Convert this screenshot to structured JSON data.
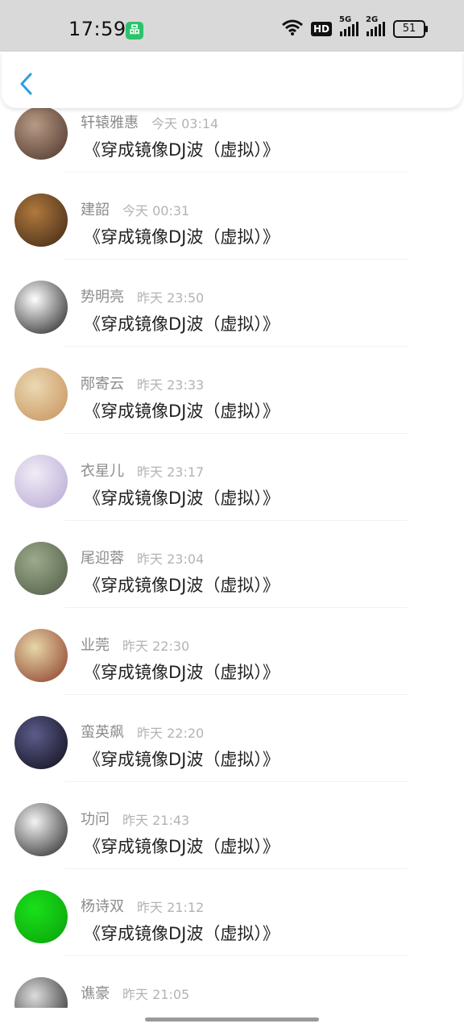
{
  "status_bar": {
    "time": "17:59",
    "app_badge": "品",
    "hd": "HD",
    "sig1": "5G",
    "sig2": "2G",
    "battery": "51"
  },
  "nav": {
    "back_icon": "chevron-left-icon",
    "accent": "#2b9de8"
  },
  "items": [
    {
      "name": "轩辕雅惠",
      "time": "今天 03:14",
      "message": "《穿成镜像DJ波（虚拟）》",
      "avatar": [
        "#b89a86",
        "#4a3328"
      ]
    },
    {
      "name": "建韶",
      "time": "今天 00:31",
      "message": "《穿成镜像DJ波（虚拟）》",
      "avatar": [
        "#b0793d",
        "#3d2714"
      ]
    },
    {
      "name": "势明亮",
      "time": "昨天 23:50",
      "message": "《穿成镜像DJ波（虚拟）》",
      "avatar": [
        "#ffffff",
        "#1c1c1c"
      ]
    },
    {
      "name": "邴寄云",
      "time": "昨天 23:33",
      "message": "《穿成镜像DJ波（虚拟）》",
      "avatar": [
        "#ead9b2",
        "#c7905a"
      ]
    },
    {
      "name": "衣星儿",
      "time": "昨天 23:17",
      "message": "《穿成镜像DJ波（虚拟）》",
      "avatar": [
        "#f0ecf6",
        "#b7a7d3"
      ]
    },
    {
      "name": "尾迎蓉",
      "time": "昨天 23:04",
      "message": "《穿成镜像DJ波（虚拟）》",
      "avatar": [
        "#9cab8c",
        "#4e5a44"
      ]
    },
    {
      "name": "业莞",
      "time": "昨天 22:30",
      "message": "《穿成镜像DJ波（虚拟）》",
      "avatar": [
        "#e7d6a8",
        "#8a3a26"
      ]
    },
    {
      "name": "蛮英飙",
      "time": "昨天 22:20",
      "message": "《穿成镜像DJ波（虚拟）》",
      "avatar": [
        "#5c5c8c",
        "#0d0d18"
      ]
    },
    {
      "name": "功问",
      "time": "昨天 21:43",
      "message": "《穿成镜像DJ波（虚拟）》",
      "avatar": [
        "#f4f4f4",
        "#222222"
      ]
    },
    {
      "name": "杨诗双",
      "time": "昨天 21:12",
      "message": "《穿成镜像DJ波（虚拟）》",
      "avatar": [
        "#1ae01a",
        "#0aa00a"
      ]
    },
    {
      "name": "谯豪",
      "time": "昨天 21:05",
      "message": "",
      "avatar": [
        "#dddddd",
        "#222222"
      ]
    }
  ]
}
